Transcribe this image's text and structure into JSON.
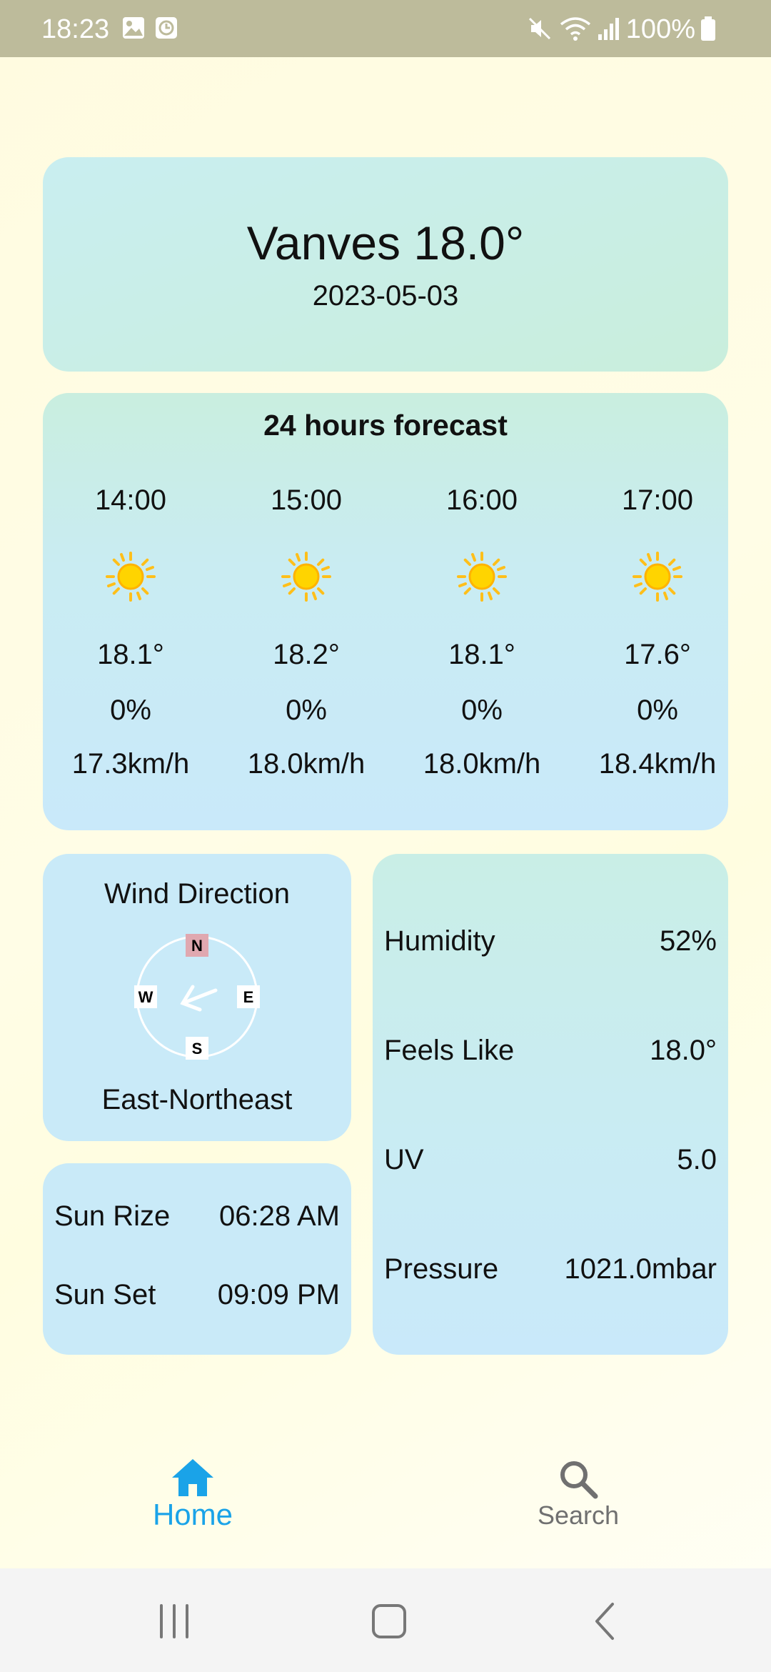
{
  "status_bar": {
    "time": "18:23",
    "battery": "100%",
    "icons": [
      "gallery-icon",
      "clock-icon",
      "mute-icon",
      "wifi-icon",
      "signal-icon",
      "battery-icon"
    ]
  },
  "header": {
    "title": "Vanves 18.0°",
    "date": "2023-05-03"
  },
  "forecast": {
    "title": "24 hours forecast",
    "hours": [
      {
        "time": "14:00",
        "icon": "sun-icon",
        "temp": "18.1°",
        "rain": "0%",
        "wind": "17.3km/h"
      },
      {
        "time": "15:00",
        "icon": "sun-icon",
        "temp": "18.2°",
        "rain": "0%",
        "wind": "18.0km/h"
      },
      {
        "time": "16:00",
        "icon": "sun-icon",
        "temp": "18.1°",
        "rain": "0%",
        "wind": "18.0km/h"
      },
      {
        "time": "17:00",
        "icon": "sun-icon",
        "temp": "17.6°",
        "rain": "0%",
        "wind": "18.4km/h"
      }
    ]
  },
  "wind": {
    "title": "Wind Direction",
    "direction": "East-Northeast",
    "compass": {
      "n": "N",
      "e": "E",
      "s": "S",
      "w": "W"
    }
  },
  "sun": {
    "rise_label": "Sun Rize",
    "rise_value": "06:28 AM",
    "set_label": "Sun Set",
    "set_value": "09:09 PM"
  },
  "stats": {
    "humidity_label": "Humidity",
    "humidity_value": "52%",
    "feels_label": "Feels Like",
    "feels_value": "18.0°",
    "uv_label": "UV",
    "uv_value": "5.0",
    "pressure_label": "Pressure",
    "pressure_value": "1021.0mbar"
  },
  "nav": {
    "home_label": "Home",
    "search_label": "Search"
  },
  "colors": {
    "accent": "#1aa3e8",
    "status_bar": "#bdbb9b",
    "card": "#c9eaf8",
    "sun": "#ffd400"
  }
}
